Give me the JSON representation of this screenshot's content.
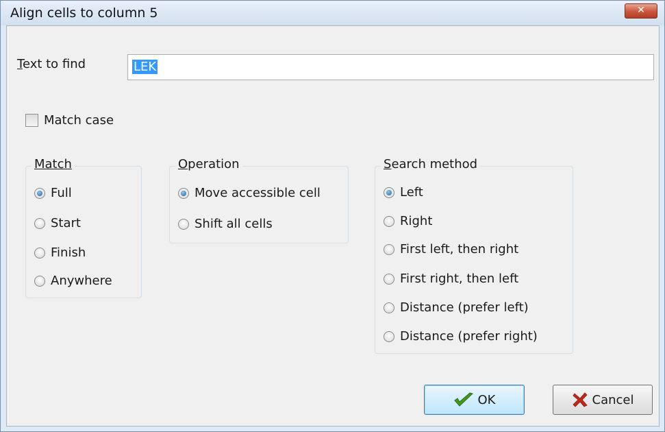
{
  "window": {
    "title": "Align cells to column 5",
    "close_glyph": "✕"
  },
  "find": {
    "label": "Text to find",
    "label_accel": "T",
    "label_rest": "ext to find",
    "value": "LEK"
  },
  "match_case": {
    "label": "Match case",
    "checked": false
  },
  "groups": {
    "match": {
      "title": "Match",
      "options": [
        "Full",
        "Start",
        "Finish",
        "Anywhere"
      ],
      "selected": "Full"
    },
    "operation": {
      "title_accel": "O",
      "title_rest": "peration",
      "title": "Operation",
      "options": [
        "Move accessible cell",
        "Shift all cells"
      ],
      "selected": "Move accessible cell"
    },
    "search_method": {
      "title_accel": "S",
      "title_rest": "earch method",
      "title": "Search method",
      "options": [
        "Left",
        "Right",
        "First left, then right",
        "First right, then left",
        "Distance (prefer left)",
        "Distance (prefer right)"
      ],
      "selected": "Left"
    }
  },
  "buttons": {
    "ok": {
      "label": "OK",
      "icon": "checkmark-icon",
      "icon_color": "#3f9a1e"
    },
    "cancel": {
      "label": "Cancel",
      "icon": "x-icon",
      "icon_color": "#c0281a"
    }
  },
  "colors": {
    "selection": "#3399ff",
    "titlebar": "#dfe9f5",
    "close_button": "#c9553c"
  }
}
